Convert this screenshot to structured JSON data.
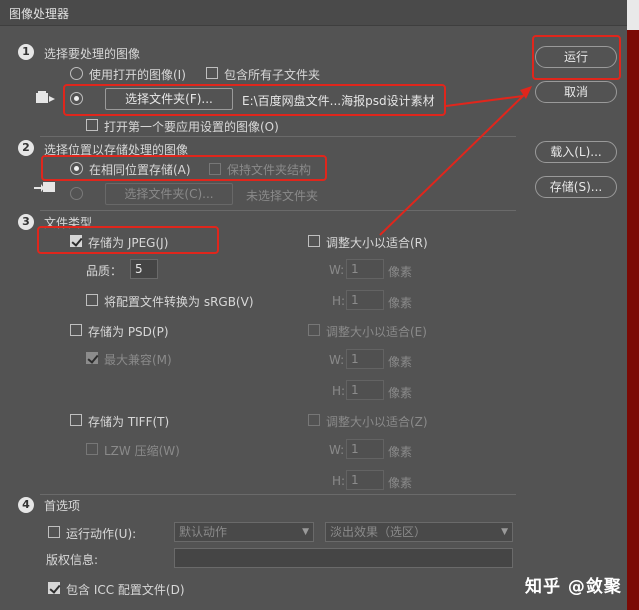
{
  "window": {
    "title": "图像处理器"
  },
  "section1": {
    "num": "1",
    "heading": "选择要处理的图像",
    "use_open_label": "使用打开的图像(I)",
    "include_subfolders_label": "包含所有子文件夹",
    "select_folder_button": "选择文件夹(F)...",
    "folder_path": "E:\\百度网盘文件...海报psd设计素材",
    "open_first_label": "打开第一个要应用设置的图像(O)"
  },
  "section2": {
    "num": "2",
    "heading": "选择位置以存储处理的图像",
    "save_same_label": "在相同位置存储(A)",
    "keep_structure_label": "保持文件夹结构",
    "select_folder_button": "选择文件夹(C)...",
    "no_folder_text": "未选择文件夹"
  },
  "section3": {
    "num": "3",
    "heading": "文件类型",
    "jpeg": {
      "save_label": "存储为 JPEG(J)",
      "resize_label": "调整大小以适合(R)",
      "quality_label": "品质：",
      "quality_value": "5",
      "w_label": "W:",
      "w_value": "1",
      "h_label": "H:",
      "h_value": "1",
      "unit": "像素",
      "srgb_label": "将配置文件转换为 sRGB(V)"
    },
    "psd": {
      "save_label": "存储为 PSD(P)",
      "resize_label": "调整大小以适合(E)",
      "compat_label": "最大兼容(M)",
      "w_label": "W:",
      "w_value": "1",
      "h_label": "H:",
      "h_value": "1",
      "unit": "像素"
    },
    "tiff": {
      "save_label": "存储为 TIFF(T)",
      "resize_label": "调整大小以适合(Z)",
      "lzw_label": "LZW 压缩(W)",
      "w_label": "W:",
      "w_value": "1",
      "h_label": "H:",
      "h_value": "1",
      "unit": "像素"
    }
  },
  "section4": {
    "num": "4",
    "heading": "首选项",
    "run_action_label": "运行动作(U):",
    "action_set": "默认动作",
    "action": "淡出效果（选区）",
    "copyright_label": "版权信息:",
    "copyright_value": "",
    "icc_label": "包含 ICC 配置文件(D)"
  },
  "side_buttons": {
    "run": "运行",
    "cancel": "取消",
    "load": "载入(L)...",
    "save": "存储(S)..."
  },
  "watermark": "知乎 @敛聚",
  "colors": {
    "highlight": "#e0261c",
    "dialog_bg": "#535353"
  }
}
